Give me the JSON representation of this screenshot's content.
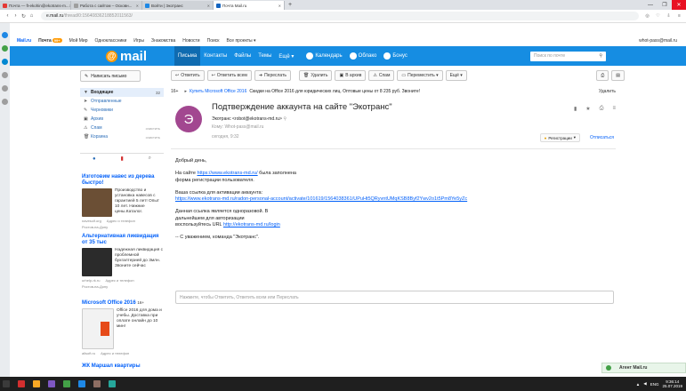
{
  "browser": {
    "tabs": [
      {
        "label": "Почта — ft-ekohin@ekotrans-m...",
        "active": false,
        "color": "#e53935"
      },
      {
        "label": "Работа с сайтом – Осковн...",
        "active": false,
        "color": "#9e9e9e"
      },
      {
        "label": "Войти | Экотранс",
        "active": false,
        "color": "#1e88e5"
      },
      {
        "label": "Почта Mail.ru",
        "active": true,
        "color": "#1565c0"
      }
    ],
    "url_host": "e.mail.ru",
    "url_path": "/thread/0:15640836218852011563/",
    "window_controls": [
      "—",
      "❐",
      "✕"
    ]
  },
  "portal": {
    "items": [
      "Mail.ru",
      "Почта",
      "Мой Мир",
      "Одноклассники",
      "Игры",
      "Знакомства",
      "Новости",
      "Поиск",
      "Все проекты ▾"
    ],
    "mail_count": "99+",
    "user": "whot-pass@mail.ru"
  },
  "header": {
    "logo_text": "mail",
    "menu": [
      {
        "label": "Письма",
        "active": true
      },
      {
        "label": "Контакты",
        "active": false
      },
      {
        "label": "Файлы",
        "active": false
      },
      {
        "label": "Темы",
        "active": false
      },
      {
        "label": "Ещё ▾",
        "active": false
      },
      {
        "label": "Календарь",
        "active": false,
        "icon": true
      },
      {
        "label": "Облако",
        "active": false,
        "icon": true
      },
      {
        "label": "Бонус",
        "active": false,
        "icon": true
      }
    ],
    "search_placeholder": "Поиск по почте"
  },
  "sidebar": {
    "compose_label": "Написать письмо",
    "folders": [
      {
        "icon": "▼",
        "label": "Входящие",
        "count": "32",
        "active": true
      },
      {
        "icon": "➤",
        "label": "Отправленные",
        "count": "",
        "active": false
      },
      {
        "icon": "✎",
        "label": "Черновики",
        "count": "",
        "active": false
      },
      {
        "icon": "▣",
        "label": "Архив",
        "count": "",
        "active": false
      },
      {
        "icon": "⚠",
        "label": "Спам",
        "count": "очистить",
        "active": false
      },
      {
        "icon": "🗑",
        "label": "Корзина",
        "count": "очистить",
        "active": false
      }
    ],
    "ads": [
      {
        "title": "Изготовим навес из дерева быстро!",
        "text": "Производство и установка навесов с гарантией 5 лет! Опыт 10 лет. Нижние цены.Каталог.",
        "source": "navesolf.org",
        "extra": "Адрес и телефон",
        "region": "Ростов-на-Дону"
      },
      {
        "title": "Альтернативная ликвидация от 35 тыс",
        "text": "Надежная ликвидация с проблемной бухгалтерией до 3млн. Звоните сейчас",
        "source": "urhelp-rk.ru",
        "extra": "Адрес и телефон",
        "region": "Ростов-на-Дону"
      },
      {
        "title": "Microsoft Office 2016",
        "title_badge": "16+",
        "text": "Office 2016 для дома и учебы. Доставка при оплате онлайн до 10 мин!",
        "source": "allsoft.ru",
        "extra": "Адрес и телефон",
        "region": ""
      },
      {
        "title": "ЖК Маршал квартиры",
        "text": "",
        "source": "",
        "extra": "",
        "region": ""
      }
    ]
  },
  "toolbar": {
    "buttons": [
      "Ответить",
      "Ответить всем",
      "Переслать",
      "Удалить",
      "В архив",
      "Спам",
      "Переместить ▾",
      "Ещё ▾"
    ]
  },
  "adline": {
    "badge": "16+",
    "link": "Купить Microsoft Office 2016",
    "text": "Скидки на Office 2016 для юридических лиц. Оптовые цены от 8 235 руб. Звоните!",
    "clear": "Удалить"
  },
  "message": {
    "avatar_letter": "Э",
    "avatar_color": "#a24790",
    "subject": "Подтверждение аккаунта на сайте \"Экотранс\"",
    "from": "Экотранс <robot@ekotrans-md.ru>",
    "to": "Кому: Whot-pass@mail.ru",
    "date": "сегодня, 9:32",
    "registration_label": "Регистрации",
    "unsubscribe_label": "Отписаться",
    "greeting": "Добрый день,",
    "line1_before": "На сайте ",
    "line1_link": "https://www.ekotrans-md.ru/",
    "line1_after": " была заполнена",
    "line2": "форма регистрации пользователя.",
    "activation_label": "Ваша ссылка для активации аккаунта:",
    "activation_link": "https://www.ekotrans-md.ru/radon-personal-account/activate/101619/1564038361/UPuHt5QRyvntUMqKSB8Byf2Ywv2o1t5Pm8Ye5yZc",
    "note1": "Данная ссылка является одноразовой. В",
    "note2": "дальнейшем для авторизации",
    "note3_before": "воспользуйтесь URL ",
    "note3_link": "http://ekotrans-md.ru/login",
    "signature": "-- С уважением, команда \"Экотранс\".",
    "reply_placeholder": "Нажмите, чтобы Ответить, Ответить всем или Переслать"
  },
  "agent": {
    "label": "Агент Mail.ru"
  },
  "taskbar": {
    "lang": "ENG",
    "time": "9:36:14",
    "date": "25.07.2019"
  }
}
